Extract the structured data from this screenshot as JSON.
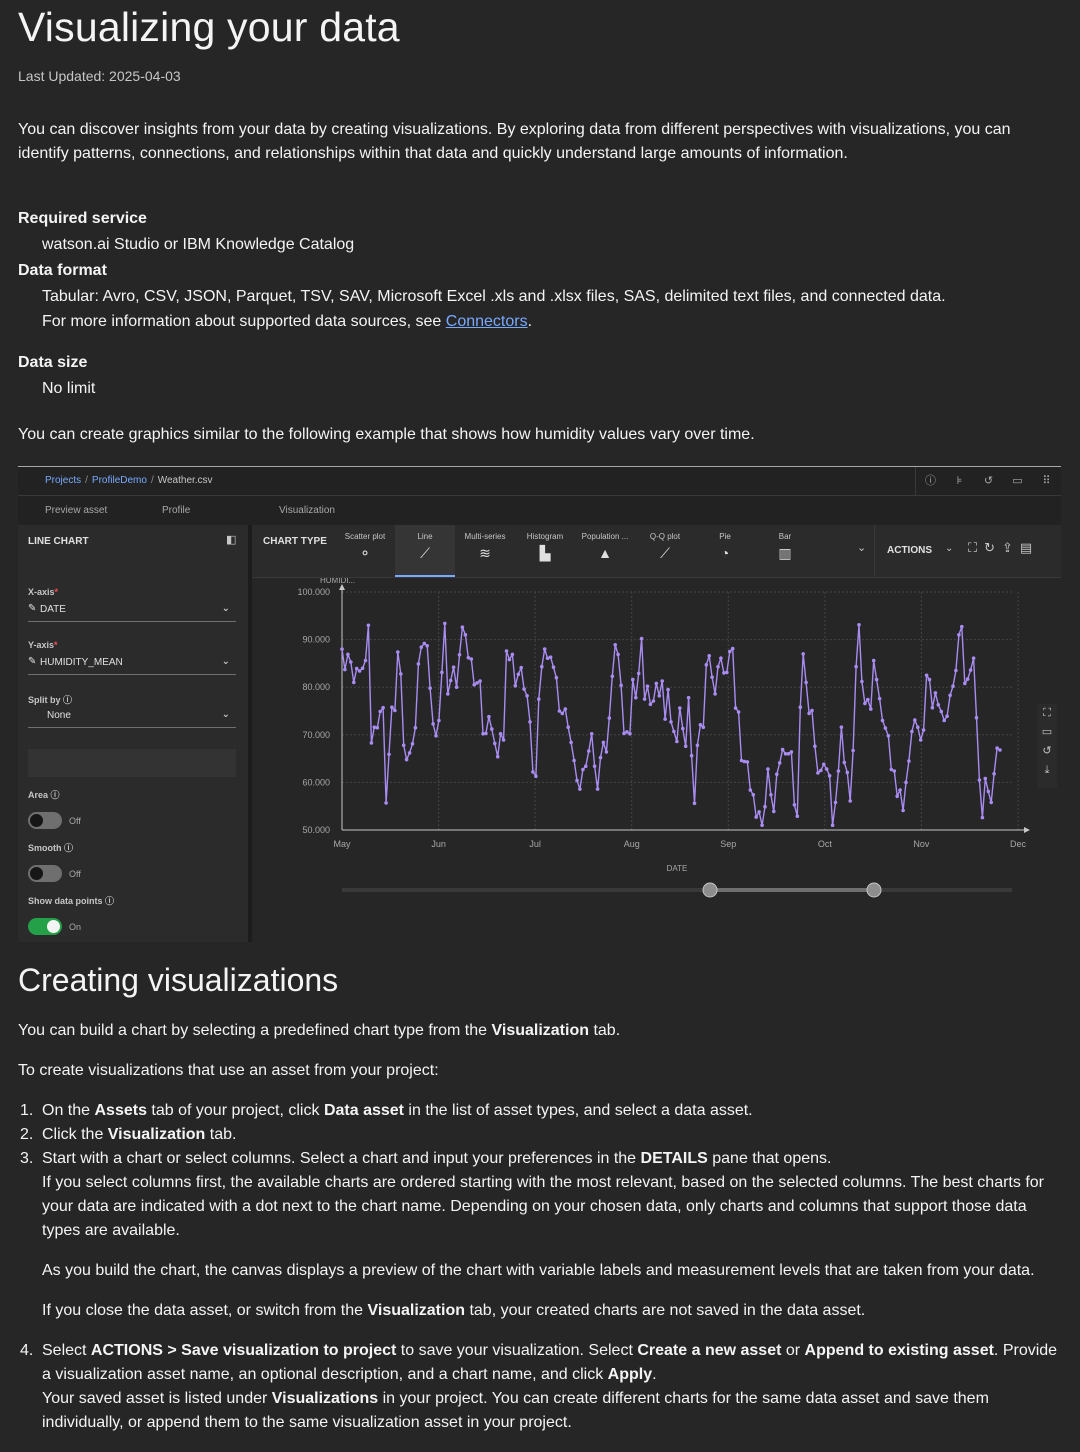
{
  "title": "Visualizing your data",
  "last_updated": "Last Updated: 2025-04-03",
  "intro": "You can discover insights from your data by creating visualizations. By exploring data from different perspectives with visualizations, you can identify patterns, connections, and relationships within that data and quickly understand large amounts of information.",
  "requirements": {
    "service_label": "Required service",
    "service_value": "watson.ai Studio or IBM Knowledge Catalog",
    "format_label": "Data format",
    "format_value": "Tabular: Avro, CSV, JSON, Parquet, TSV, SAV, Microsoft Excel .xls and .xlsx files, SAS, delimited text files, and connected data.",
    "format_more_prefix": "For more information about supported data sources, see ",
    "format_more_link": "Connectors",
    "format_more_suffix": ".",
    "size_label": "Data size",
    "size_value": "No limit"
  },
  "example_text": "You can create graphics similar to the following example that shows how humidity values vary over time.",
  "screenshot": {
    "breadcrumb": {
      "projects": "Projects",
      "project": "ProfileDemo",
      "file": "Weather.csv"
    },
    "tabs": {
      "preview": "Preview asset",
      "profile": "Profile",
      "visualization": "Visualization"
    },
    "left_panel": {
      "title": "LINE CHART",
      "x_axis_label": "X-axis",
      "x_axis_value": "DATE",
      "y_axis_label": "Y-axis",
      "y_axis_value": "HUMIDITY_MEAN",
      "split_label": "Split by",
      "split_value": "None",
      "area_label": "Area",
      "area_state": "Off",
      "smooth_label": "Smooth",
      "smooth_state": "Off",
      "points_label": "Show data points",
      "points_state": "On",
      "required_mark": "*"
    },
    "chart_type_label": "CHART TYPE",
    "chart_types": [
      "Scatter plot",
      "Line",
      "Multi-series",
      "Histogram",
      "Population ...",
      "Q-Q plot",
      "Pie",
      "Bar"
    ],
    "actions_label": "ACTIONS"
  },
  "chart_data": {
    "type": "line",
    "ylabel": "HUMIDI...",
    "xlabel": "DATE",
    "ylim": [
      50,
      100
    ],
    "y_ticks": [
      "50.000",
      "60.000",
      "70.000",
      "80.000",
      "90.000",
      "100.000"
    ],
    "x_ticks": [
      "May",
      "Jun",
      "Jul",
      "Aug",
      "Sep",
      "Oct",
      "Nov",
      "Dec"
    ],
    "grid": true,
    "show_points": true,
    "line_color": "#a98cf2",
    "values": [
      88.0,
      83.7,
      86.9,
      85.3,
      81.0,
      83.9,
      83.4,
      84.0,
      85.6,
      93.0,
      68.3,
      71.6,
      71.5,
      74.9,
      75.7,
      55.7,
      65.9,
      75.8,
      75.1,
      87.4,
      82.8,
      67.8,
      64.8,
      66.2,
      68.1,
      71.5,
      84.9,
      88.4,
      89.2,
      88.7,
      79.8,
      72.3,
      69.8,
      73.0,
      83.1,
      93.4,
      78.6,
      81.4,
      84.2,
      80.0,
      86.8,
      92.6,
      91.0,
      86.2,
      85.9,
      80.5,
      80.9,
      81.3,
      70.2,
      70.3,
      73.8,
      71.2,
      68.2,
      65.4,
      70.2,
      68.9,
      87.6,
      85.8,
      86.9,
      80.3,
      82.7,
      84.1,
      79.6,
      78.2,
      72.7,
      62.2,
      61.3,
      77.5,
      84.3,
      88.0,
      86.1,
      86.3,
      84.2,
      82.0,
      75.0,
      74.5,
      75.4,
      71.6,
      68.4,
      64.6,
      60.4,
      58.6,
      62.7,
      63.4,
      66.6,
      70.2,
      63.4,
      58.6,
      65.2,
      68.4,
      66.4,
      73.5,
      82.3,
      88.9,
      86.9,
      80.4,
      70.3,
      70.6,
      70.2,
      81.6,
      77.8,
      82.9,
      90.2,
      77.5,
      80.2,
      76.4,
      77.1,
      80.8,
      78.2,
      81.3,
      73.3,
      79.5,
      72.7,
      70.7,
      68.6,
      75.6,
      71.3,
      67.6,
      77.8,
      65.6,
      55.6,
      67.8,
      72.1,
      71.6,
      84.7,
      86.6,
      82.1,
      78.6,
      84.3,
      86.1,
      83.0,
      83.1,
      87.5,
      88.1,
      75.6,
      74.8,
      64.6,
      64.4,
      64.3,
      58.4,
      57.4,
      52.7,
      53.8,
      51.0,
      54.9,
      62.8,
      57.4,
      53.9,
      61.7,
      64.1,
      66.9,
      66.0,
      66.0,
      66.4,
      55.3,
      52.9,
      75.8,
      87.0,
      81.0,
      74.5,
      75.1,
      67.6,
      62.0,
      62.5,
      63.8,
      62.8,
      61.4,
      51.0,
      55.8,
      62.4,
      71.6,
      64.2,
      62.1,
      56.1,
      66.7,
      84.3,
      93.1,
      81.2,
      76.6,
      77.4,
      75.4,
      85.6,
      81.6,
      77.6,
      73.0,
      71.4,
      69.8,
      62.7,
      62.4,
      57.1,
      58.4,
      54.1,
      60.0,
      64.5,
      70.7,
      73.1,
      71.6,
      68.9,
      71.0,
      82.5,
      81.6,
      75.7,
      78.8,
      76.3,
      74.9,
      73.0,
      73.9,
      78.3,
      80.2,
      83.5,
      91.0,
      92.7,
      80.8,
      81.7,
      83.6,
      86.1,
      73.6,
      60.5,
      52.6,
      60.8,
      58.1,
      55.8,
      61.8,
      67.2,
      66.8
    ]
  },
  "section2": {
    "title": "Creating visualizations",
    "p1_a": "You can build a chart by selecting a predefined chart type from the ",
    "p1_b": "Visualization",
    "p1_c": " tab.",
    "p2": "To create visualizations that use an asset from your project:",
    "steps": [
      {
        "num": "1.",
        "a": "On the ",
        "b": "Assets",
        "c": " tab of your project, click ",
        "d": "Data asset",
        "e": " in the list of asset types, and select a data asset."
      },
      {
        "num": "2.",
        "a": "Click the ",
        "b": "Visualization",
        "c": " tab."
      },
      {
        "num": "3.",
        "a": "Start with a chart or select columns. Select a chart and input your preferences in the ",
        "b": "DETAILS",
        "c": " pane that opens.",
        "d": "If you select columns first, the available charts are ordered starting with the most relevant, based on the selected columns. The best charts for your data are indicated with a dot next to the chart name. Depending on your chosen data, only charts and columns that support those data types are available.",
        "e": "As you build the chart, the canvas displays a preview of the chart with variable labels and measurement levels that are taken from your data.",
        "f1": "If you close the data asset, or switch from the ",
        "f2": "Visualization",
        "f3": " tab, your created charts are not saved in the data asset."
      },
      {
        "num": "4.",
        "a": "Select ",
        "b": "ACTIONS > Save visualization to project",
        "c": " to save your visualization. Select ",
        "d": "Create a new asset",
        "e": " or ",
        "f": "Append to existing asset",
        "g": ". Provide a visualization asset name, an optional description, and a chart name, and click ",
        "h": "Apply",
        "i": ".",
        "j": "Your saved asset is listed under ",
        "k": "Visualizations",
        "l": " in your project. You can create different charts for the same data asset and save them individually, or append them to the same visualization asset in your project."
      }
    ]
  }
}
